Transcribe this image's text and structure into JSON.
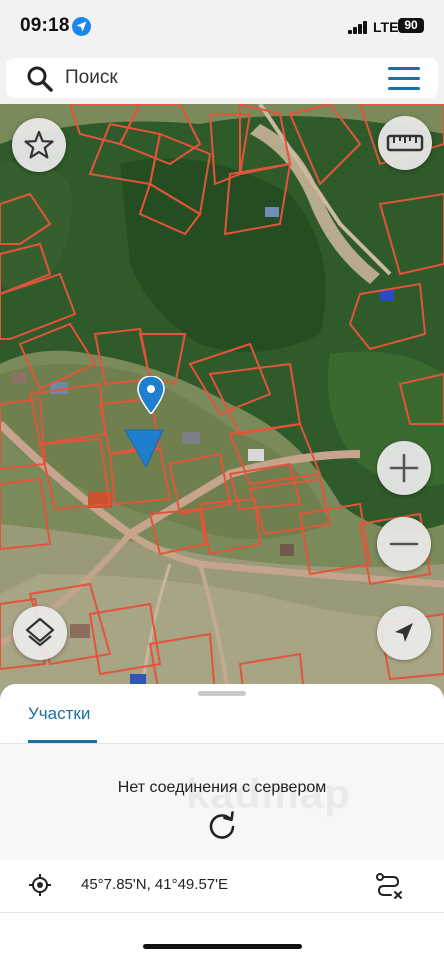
{
  "status_bar": {
    "time": "09:18",
    "network": "LTE",
    "battery": "90"
  },
  "search": {
    "placeholder": "Поиск"
  },
  "map": {
    "watermark": "kadmap",
    "parcel_color": "#e2553a",
    "controls": [
      "favorites-star-icon",
      "ruler-icon",
      "zoom-in-icon",
      "zoom-out-icon",
      "layers-icon",
      "my-location-arrow-icon"
    ]
  },
  "sheet": {
    "tab_label": "Участки",
    "error_message": "Нет соединения с сервером",
    "coordinates": "45°7.85'N, 41°49.57'E"
  },
  "colors": {
    "accent": "#1b6fa3",
    "marker": "#1e7fcf"
  }
}
